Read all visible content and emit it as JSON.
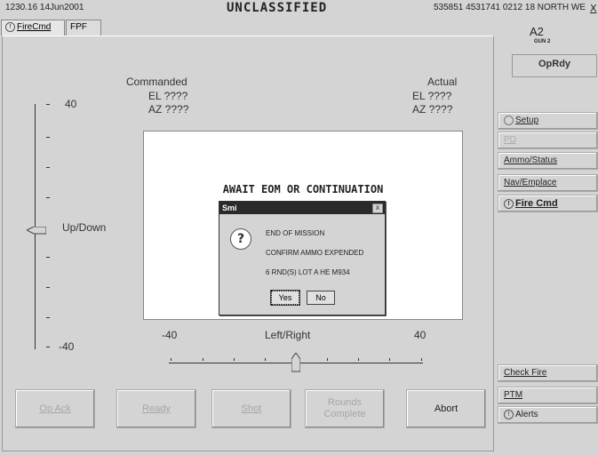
{
  "status_bar": {
    "datetime": "1230.16 14Jun2001",
    "classification": "UNCLASSIFIED",
    "grid": "535851 4531741 0212 18 NORTH WE",
    "close": "X"
  },
  "tabs": [
    {
      "label": "FireCmd",
      "active": true
    },
    {
      "label": "FPF",
      "active": false
    }
  ],
  "commanded": {
    "title": "Commanded",
    "el": "EL ????",
    "az": "AZ ????"
  },
  "actual": {
    "title": "Actual",
    "el": "EL ????",
    "az": "AZ ????"
  },
  "vertical_slider": {
    "top": "40",
    "bottom": "-40",
    "label": "Up/Down"
  },
  "horizontal_slider": {
    "left": "-40",
    "right": "40",
    "label": "Left/Right"
  },
  "status_message": "AWAIT EOM OR CONTINUATION",
  "dialog": {
    "title": "Smi",
    "close": "x",
    "icon": "?",
    "lines": [
      "END OF MISSION",
      "CONFIRM AMMO EXPENDED",
      "6 RND(S) LOT A HE  M934"
    ],
    "yes": "Yes",
    "no": "No"
  },
  "bottom_buttons": {
    "op_ack": "Op Ack",
    "ready": "Ready",
    "shot": "Shot",
    "rounds_complete_1": "Rounds",
    "rounds_complete_2": "Complete",
    "abort": "Abort"
  },
  "right_panel": {
    "gun_id": "A2",
    "gun_sub": "GUN 2",
    "status": "OpRdy",
    "menu": [
      "Setup",
      "PD",
      "Ammo/Status",
      "Nav/Emplace",
      "Fire Cmd"
    ],
    "lower_menu": [
      "Check Fire",
      "PTM",
      "Alerts"
    ]
  }
}
